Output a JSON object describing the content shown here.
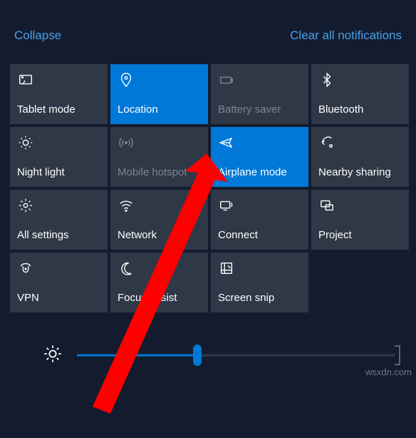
{
  "header": {
    "collapse": "Collapse",
    "clear": "Clear all notifications"
  },
  "tiles": [
    {
      "name": "tablet-mode",
      "label": "Tablet mode",
      "icon": "tablet-icon",
      "active": false,
      "disabled": false
    },
    {
      "name": "location",
      "label": "Location",
      "icon": "location-icon",
      "active": true,
      "disabled": false
    },
    {
      "name": "battery-saver",
      "label": "Battery saver",
      "icon": "battery-icon",
      "active": false,
      "disabled": true
    },
    {
      "name": "bluetooth",
      "label": "Bluetooth",
      "icon": "bluetooth-icon",
      "active": false,
      "disabled": false
    },
    {
      "name": "night-light",
      "label": "Night light",
      "icon": "sun-icon",
      "active": false,
      "disabled": false
    },
    {
      "name": "mobile-hotspot",
      "label": "Mobile hotspot",
      "icon": "hotspot-icon",
      "active": false,
      "disabled": true
    },
    {
      "name": "airplane-mode",
      "label": "Airplane mode",
      "icon": "airplane-icon",
      "active": true,
      "disabled": false
    },
    {
      "name": "nearby-sharing",
      "label": "Nearby sharing",
      "icon": "share-icon",
      "active": false,
      "disabled": false
    },
    {
      "name": "all-settings",
      "label": "All settings",
      "icon": "gear-icon",
      "active": false,
      "disabled": false
    },
    {
      "name": "network",
      "label": "Network",
      "icon": "wifi-icon",
      "active": false,
      "disabled": false
    },
    {
      "name": "connect",
      "label": "Connect",
      "icon": "connect-icon",
      "active": false,
      "disabled": false
    },
    {
      "name": "project",
      "label": "Project",
      "icon": "project-icon",
      "active": false,
      "disabled": false
    },
    {
      "name": "vpn",
      "label": "VPN",
      "icon": "vpn-icon",
      "active": false,
      "disabled": false
    },
    {
      "name": "focus-assist",
      "label": "Focus assist",
      "icon": "moon-icon",
      "active": false,
      "disabled": false
    },
    {
      "name": "screen-snip",
      "label": "Screen snip",
      "icon": "snip-icon",
      "active": false,
      "disabled": false
    }
  ],
  "brightness": {
    "value": 38
  },
  "watermark": "wsxdn.com",
  "colors": {
    "accent": "#0078d7",
    "bg": "#131c2e",
    "tile": "#2f3846"
  }
}
